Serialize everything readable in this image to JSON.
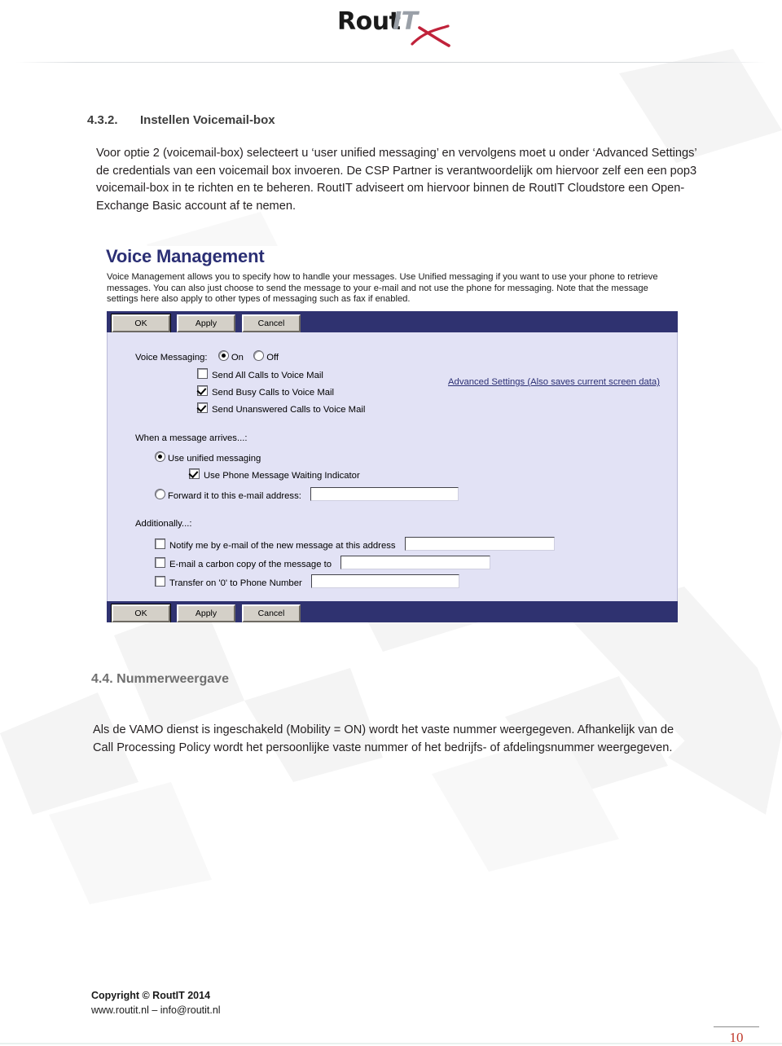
{
  "document": {
    "logo": {
      "brand_primary": "Rout",
      "brand_secondary": "IT",
      "swoosh_color": "#c0223a"
    }
  },
  "sections": {
    "voicemail": {
      "number": "4.3.2.",
      "title": "Instellen Voicemail-box",
      "paragraph": "Voor optie 2 (voicemail-box) selecteert u ‘user unified messaging’ en vervolgens moet u onder ‘Advanced Settings’ de credentials van een voicemail box invoeren. De CSP Partner is verantwoordelijk om hiervoor zelf een een pop3 voicemail-box in te richten en te beheren. RoutIT adviseert om hiervoor binnen de RoutIT Cloudstore een Open-Exchange Basic account af te nemen."
    },
    "nummerweergave": {
      "title": "4.4. Nummerweergave",
      "paragraph": "Als de VAMO dienst is ingeschakeld (Mobility = ON) wordt het vaste nummer weergegeven. Afhankelijk van de Call Processing Policy wordt het persoonlijke vaste nummer of het bedrijfs- of afdelingsnummer weergegeven."
    }
  },
  "screenshot": {
    "title": "Voice Management",
    "description": "Voice Management allows you to specify how to handle your messages. Use Unified messaging if you want to use your phone to retrieve messages. You can also just choose to send the message to your e-mail and not use the phone for messaging. Note that the message settings here also apply to other types of messaging such as fax if enabled.",
    "buttons": {
      "ok": "OK",
      "apply": "Apply",
      "cancel": "Cancel"
    },
    "voice_messaging": {
      "label": "Voice Messaging:",
      "on_label": "On",
      "off_label": "Off",
      "selected": "On",
      "checkboxes": [
        {
          "label": "Send All Calls to Voice Mail",
          "checked": false
        },
        {
          "label": "Send Busy Calls to Voice Mail",
          "checked": true
        },
        {
          "label": "Send Unanswered Calls to Voice Mail",
          "checked": true
        }
      ]
    },
    "when_message_arrives": {
      "label": "When a message arrives...:",
      "options": [
        {
          "label": "Use unified messaging",
          "selected": true
        },
        {
          "label": "Forward it to this e-mail address:",
          "selected": false
        }
      ],
      "mwi": {
        "label": "Use Phone Message Waiting Indicator",
        "checked": true
      },
      "forward_email_value": "",
      "advanced_settings_link": "Advanced Settings (Also saves current screen data)"
    },
    "additionally": {
      "label": "Additionally...:",
      "rows": [
        {
          "label": "Notify me by e-mail of the new message at this address",
          "checked": false,
          "value": ""
        },
        {
          "label": "E-mail a carbon copy of the message to",
          "checked": false,
          "value": ""
        },
        {
          "label": "Transfer on '0' to Phone Number",
          "checked": false,
          "value": ""
        }
      ]
    },
    "colors": {
      "header_blue": "#2b2f74",
      "bar_blue": "#2f3270",
      "panel_bg": "#e2e2f5"
    }
  },
  "footer": {
    "copyright": "Copyright © RoutIT 2014",
    "contact": "www.routit.nl – info@routit.nl",
    "page_number": "10",
    "page_number_color": "#c0392b"
  }
}
